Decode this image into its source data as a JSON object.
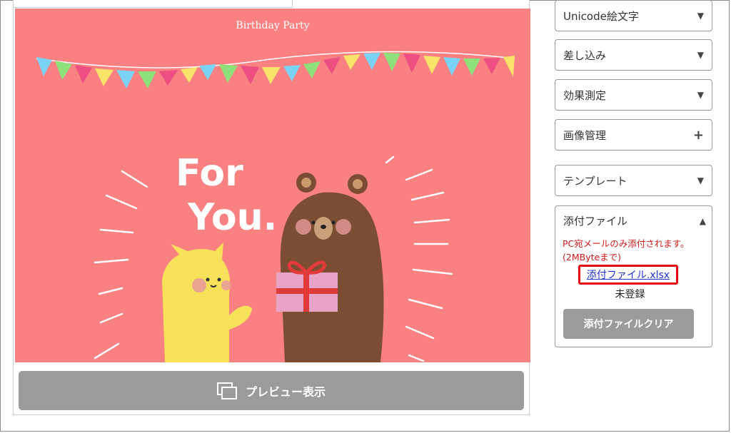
{
  "preview": {
    "email_title": "Birthday Party",
    "headline_line1": "For",
    "headline_line2": "You.",
    "preview_button_label": "プレビュー表示",
    "preview_icon": "window-copy-icon"
  },
  "sidebar": {
    "sections": [
      {
        "label": "Unicode絵文字",
        "indicator": "▼"
      },
      {
        "label": "差し込み",
        "indicator": "▼"
      },
      {
        "label": "効果測定",
        "indicator": "▼"
      },
      {
        "label": "画像管理",
        "indicator": "+"
      },
      {
        "label": "テンプレート",
        "indicator": "▼"
      }
    ],
    "attachment": {
      "label": "添付ファイル",
      "indicator": "▲",
      "note_line1": "PC宛メールのみ添付されます。",
      "note_line2": "(2MByteまで)",
      "file_link": "添付ファイル.xlsx",
      "status": "未登録",
      "clear_button": "添付ファイルクリア"
    }
  },
  "colors": {
    "canvas_bg": "#f98181",
    "button_gray": "#9b9b9b",
    "highlight_red": "#e60012",
    "note_red": "#d11b1b",
    "link_blue": "#2233cc"
  }
}
